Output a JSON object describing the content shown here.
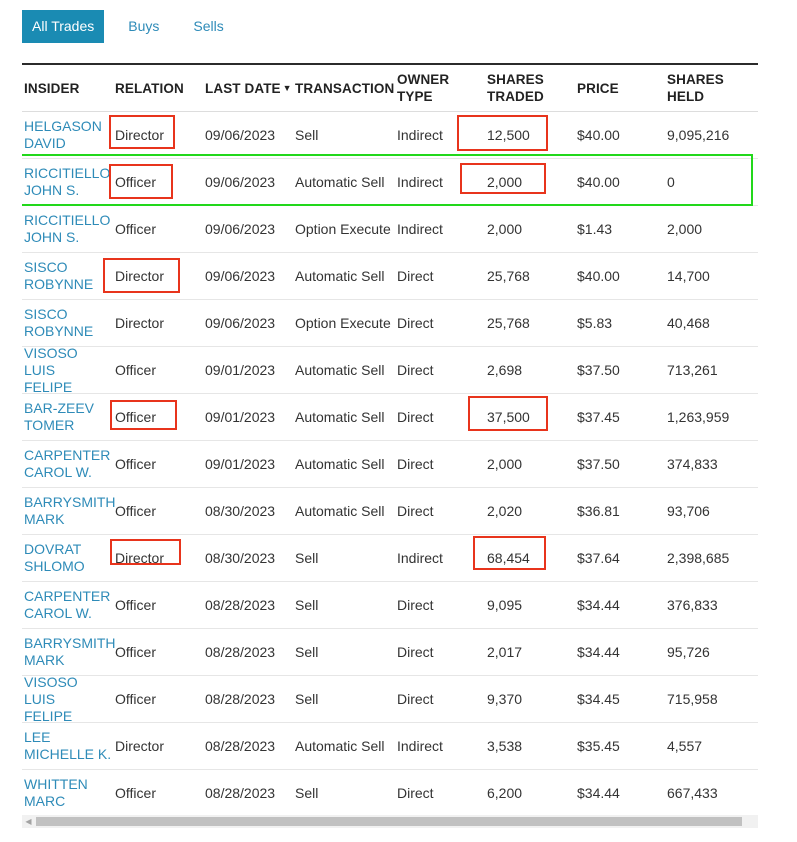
{
  "tabs": [
    {
      "label": "All Trades",
      "active": true
    },
    {
      "label": "Buys",
      "active": false
    },
    {
      "label": "Sells",
      "active": false
    }
  ],
  "table": {
    "headers": {
      "insider": "INSIDER",
      "relation": "RELATION",
      "last_date": "LAST DATE",
      "last_date_sort": "▼",
      "transaction": "TRANSACTION",
      "owner_type_1": "OWNER",
      "owner_type_2": "TYPE",
      "shares_traded_1": "SHARES",
      "shares_traded_2": "TRADED",
      "price": "PRICE",
      "shares_held_1": "SHARES",
      "shares_held_2": "HELD"
    },
    "rows": [
      {
        "insider_1": "HELGASON",
        "insider_2": "DAVID",
        "relation": "Director",
        "last_date": "09/06/2023",
        "transaction": "Sell",
        "owner_type": "Indirect",
        "shares_traded": "12,500",
        "price": "$40.00",
        "shares_held": "9,095,216"
      },
      {
        "insider_1": "RICCITIELLO",
        "insider_2": "JOHN S.",
        "relation": "Officer",
        "last_date": "09/06/2023",
        "transaction": "Automatic Sell",
        "owner_type": "Indirect",
        "shares_traded": "2,000",
        "price": "$40.00",
        "shares_held": "0"
      },
      {
        "insider_1": "RICCITIELLO",
        "insider_2": "JOHN S.",
        "relation": "Officer",
        "last_date": "09/06/2023",
        "transaction": "Option Execute",
        "owner_type": "Indirect",
        "shares_traded": "2,000",
        "price": "$1.43",
        "shares_held": "2,000"
      },
      {
        "insider_1": "SISCO",
        "insider_2": "ROBYNNE",
        "relation": "Director",
        "last_date": "09/06/2023",
        "transaction": "Automatic Sell",
        "owner_type": "Direct",
        "shares_traded": "25,768",
        "price": "$40.00",
        "shares_held": "14,700"
      },
      {
        "insider_1": "SISCO",
        "insider_2": "ROBYNNE",
        "relation": "Director",
        "last_date": "09/06/2023",
        "transaction": "Option Execute",
        "owner_type": "Direct",
        "shares_traded": "25,768",
        "price": "$5.83",
        "shares_held": "40,468"
      },
      {
        "insider_1": "VISOSO LUIS",
        "insider_2": "FELIPE",
        "relation": "Officer",
        "last_date": "09/01/2023",
        "transaction": "Automatic Sell",
        "owner_type": "Direct",
        "shares_traded": "2,698",
        "price": "$37.50",
        "shares_held": "713,261"
      },
      {
        "insider_1": "BAR-ZEEV",
        "insider_2": "TOMER",
        "relation": "Officer",
        "last_date": "09/01/2023",
        "transaction": "Automatic Sell",
        "owner_type": "Direct",
        "shares_traded": "37,500",
        "price": "$37.45",
        "shares_held": "1,263,959"
      },
      {
        "insider_1": "CARPENTER",
        "insider_2": "CAROL W.",
        "relation": "Officer",
        "last_date": "09/01/2023",
        "transaction": "Automatic Sell",
        "owner_type": "Direct",
        "shares_traded": "2,000",
        "price": "$37.50",
        "shares_held": "374,833"
      },
      {
        "insider_1": "BARRYSMITH",
        "insider_2": "MARK",
        "relation": "Officer",
        "last_date": "08/30/2023",
        "transaction": "Automatic Sell",
        "owner_type": "Direct",
        "shares_traded": "2,020",
        "price": "$36.81",
        "shares_held": "93,706"
      },
      {
        "insider_1": "DOVRAT",
        "insider_2": "SHLOMO",
        "relation": "Director",
        "last_date": "08/30/2023",
        "transaction": "Sell",
        "owner_type": "Indirect",
        "shares_traded": "68,454",
        "price": "$37.64",
        "shares_held": "2,398,685"
      },
      {
        "insider_1": "CARPENTER",
        "insider_2": "CAROL W.",
        "relation": "Officer",
        "last_date": "08/28/2023",
        "transaction": "Sell",
        "owner_type": "Direct",
        "shares_traded": "9,095",
        "price": "$34.44",
        "shares_held": "376,833"
      },
      {
        "insider_1": "BARRYSMITH",
        "insider_2": "MARK",
        "relation": "Officer",
        "last_date": "08/28/2023",
        "transaction": "Sell",
        "owner_type": "Direct",
        "shares_traded": "2,017",
        "price": "$34.44",
        "shares_held": "95,726"
      },
      {
        "insider_1": "VISOSO LUIS",
        "insider_2": "FELIPE",
        "relation": "Officer",
        "last_date": "08/28/2023",
        "transaction": "Sell",
        "owner_type": "Direct",
        "shares_traded": "9,370",
        "price": "$34.45",
        "shares_held": "715,958"
      },
      {
        "insider_1": "LEE",
        "insider_2": "MICHELLE K.",
        "relation": "Director",
        "last_date": "08/28/2023",
        "transaction": "Automatic Sell",
        "owner_type": "Indirect",
        "shares_traded": "3,538",
        "price": "$35.45",
        "shares_held": "4,557"
      },
      {
        "insider_1": "WHITTEN",
        "insider_2": "MARC",
        "relation": "Officer",
        "last_date": "08/28/2023",
        "transaction": "Sell",
        "owner_type": "Direct",
        "shares_traded": "6,200",
        "price": "$34.44",
        "shares_held": "667,433"
      }
    ]
  },
  "colors": {
    "link": "#2e8bb8",
    "active_tab_bg": "#1a8bb3",
    "red_highlight": "#e8341c",
    "green_highlight": "#22d81b"
  },
  "icons": {
    "scroll_left": "chevron-left-icon"
  },
  "scroll_left_glyph": "◀"
}
